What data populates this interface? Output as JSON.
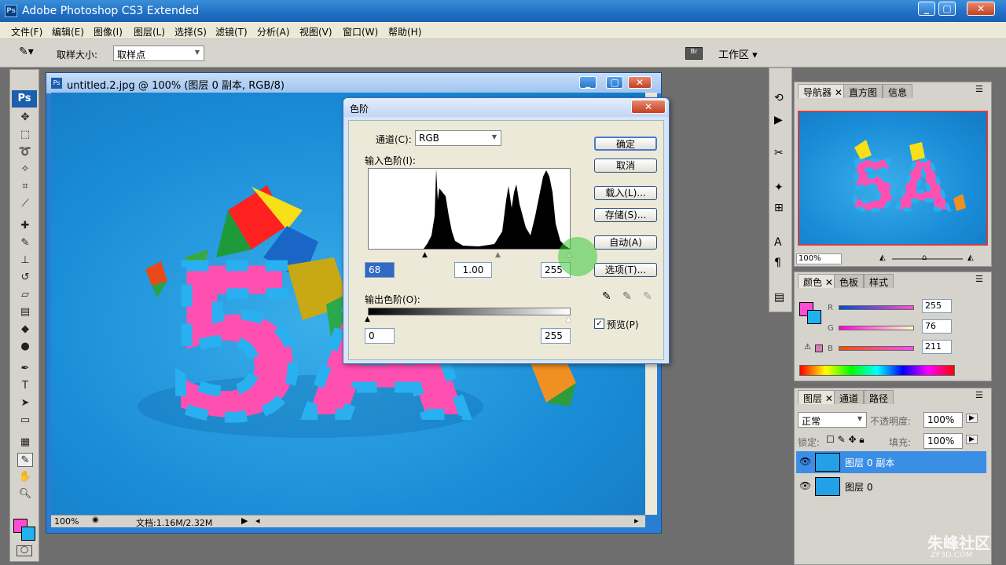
{
  "app": {
    "title": "Adobe Photoshop CS3 Extended",
    "logo": "Ps"
  },
  "menu": [
    "文件(F)",
    "编辑(E)",
    "图像(I)",
    "图层(L)",
    "选择(S)",
    "滤镜(T)",
    "分析(A)",
    "视图(V)",
    "窗口(W)",
    "帮助(H)"
  ],
  "options": {
    "sample_size_label": "取样大小:",
    "sample_size_value": "取样点",
    "workspace_label": "工作区"
  },
  "document": {
    "title": "untitled.2.jpg @ 100% (图层 0 副本, RGB/8)",
    "zoom": "100%",
    "doc_info": "文档:1.16M/2.32M"
  },
  "canvas_text": "5A",
  "levels_dialog": {
    "title": "色阶",
    "channel_label": "通道(C):",
    "channel_value": "RGB",
    "input_label": "输入色阶(I):",
    "input_black": "68",
    "input_gamma": "1.00",
    "input_white": "255",
    "output_label": "输出色阶(O):",
    "output_black": "0",
    "output_white": "255",
    "buttons": [
      "确定",
      "取消",
      "载入(L)...",
      "存储(S)...",
      "自动(A)",
      "选项(T)..."
    ],
    "preview_label": "预览(P)"
  },
  "navigator": {
    "tabs": [
      "导航器",
      "直方图",
      "信息"
    ],
    "zoom": "100%"
  },
  "color_panel": {
    "tabs": [
      "颜色",
      "色板",
      "样式"
    ],
    "r_label": "R",
    "g_label": "G",
    "b_label": "B",
    "r": "255",
    "g": "76",
    "b": "211",
    "fg_color": "#ff4cd3",
    "bg_color": "#21b1ee"
  },
  "layers_panel": {
    "tabs": [
      "图层",
      "通道",
      "路径"
    ],
    "blend_mode": "正常",
    "opacity_label": "不透明度:",
    "opacity": "100%",
    "lock_label": "锁定:",
    "fill_label": "填充:",
    "fill": "100%",
    "layers": [
      {
        "name": "图层 0 副本",
        "selected": true
      },
      {
        "name": "图层 0",
        "selected": false
      }
    ]
  },
  "watermark": {
    "text": "朱峰社区",
    "sub": "ZF3D.COM"
  }
}
